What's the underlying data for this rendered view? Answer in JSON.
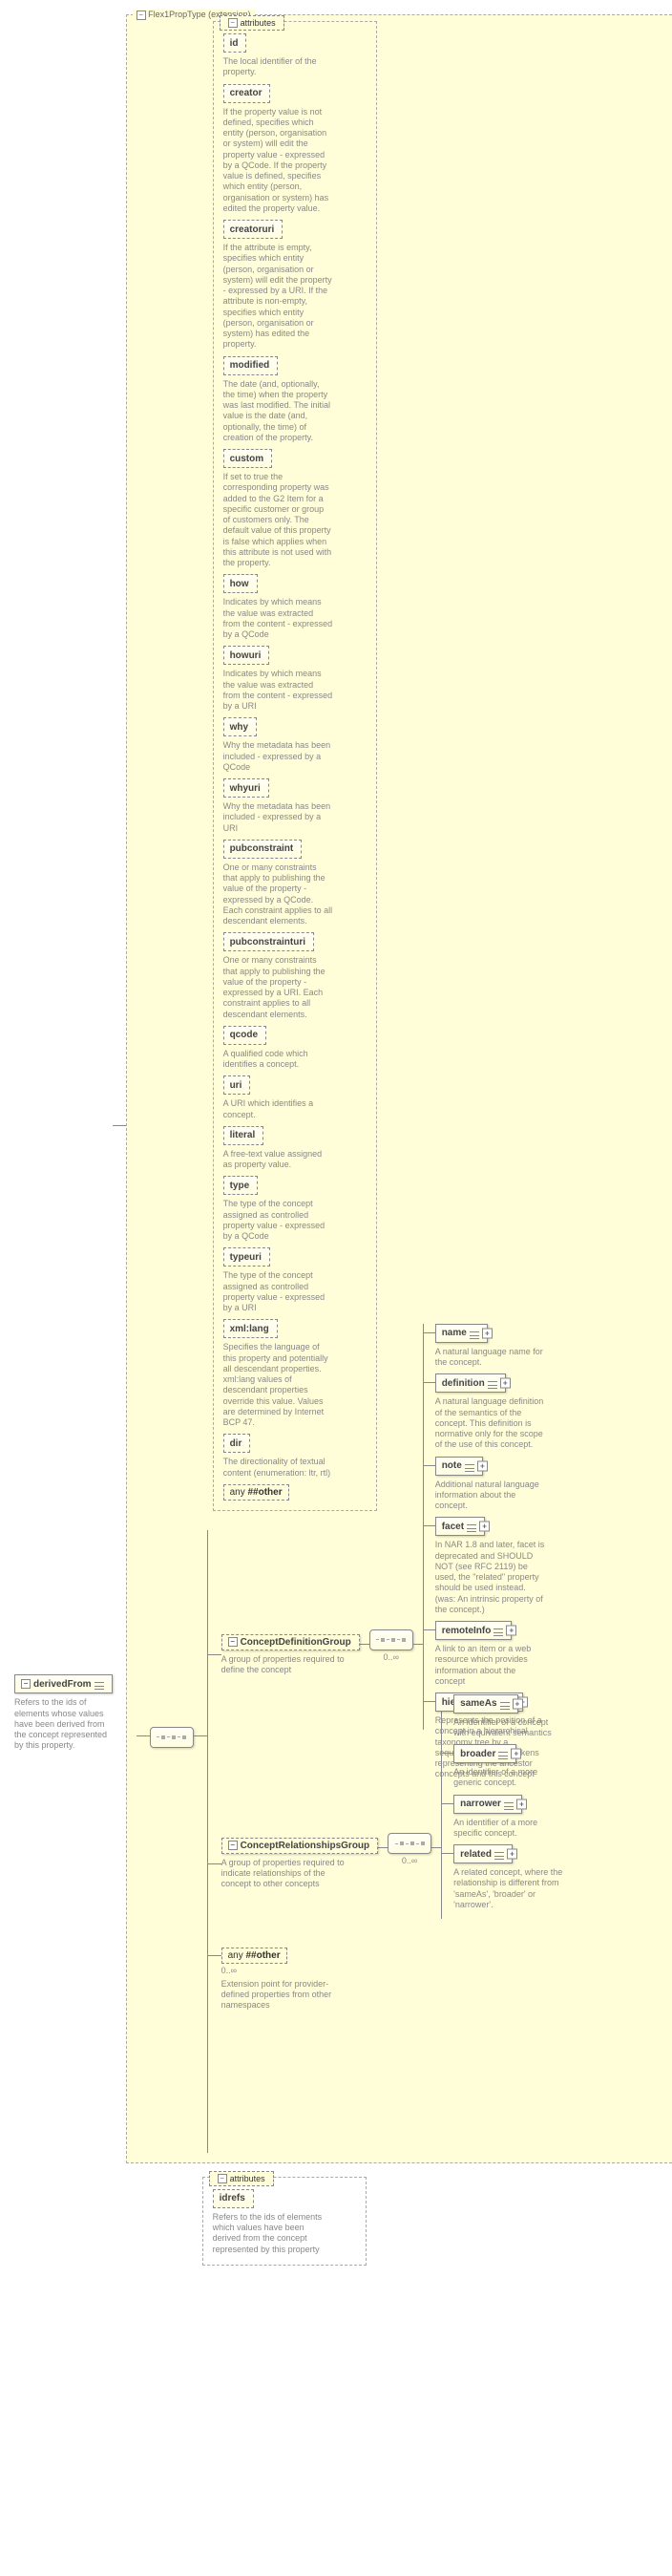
{
  "root": {
    "name": "derivedFrom",
    "desc": "Refers to the ids of elements whose values have been derived from the concept represented by this property."
  },
  "extension_label": "Flex1PropType (extension)",
  "attributes_label": "attributes",
  "attrs1": [
    {
      "name": "id",
      "desc": "The local identifier of the property."
    },
    {
      "name": "creator",
      "desc": "If the property value is not defined, specifies which entity (person, organisation or system) will edit the property value - expressed by a QCode. If the property value is defined, specifies which entity (person, organisation or system) has edited the property value."
    },
    {
      "name": "creatoruri",
      "desc": "If the attribute is empty, specifies which entity (person, organisation or system) will edit the property - expressed by a URI. If the attribute is non-empty, specifies which entity (person, organisation or system) has edited the property."
    },
    {
      "name": "modified",
      "desc": "The date (and, optionally, the time) when the property was last modified. The initial value is the date (and, optionally, the time) of creation of the property."
    },
    {
      "name": "custom",
      "desc": "If set to true the corresponding property was added to the G2 Item for a specific customer or group of customers only. The default value of this property is false which applies when this attribute is not used with the property."
    },
    {
      "name": "how",
      "desc": "Indicates by which means the value was extracted from the content - expressed by a QCode"
    },
    {
      "name": "howuri",
      "desc": "Indicates by which means the value was extracted from the content - expressed by a URI"
    },
    {
      "name": "why",
      "desc": "Why the metadata has been included - expressed by a QCode"
    },
    {
      "name": "whyuri",
      "desc": "Why the metadata has been included - expressed by a URI"
    },
    {
      "name": "pubconstraint",
      "desc": "One or many constraints that apply to publishing the value of the property - expressed by a QCode. Each constraint applies to all descendant elements."
    },
    {
      "name": "pubconstrainturi",
      "desc": "One or many constraints that apply to publishing the value of the property - expressed by a URI. Each constraint applies to all descendant elements."
    },
    {
      "name": "qcode",
      "desc": "A qualified code which identifies a concept."
    },
    {
      "name": "uri",
      "desc": "A URI which identifies a concept."
    },
    {
      "name": "literal",
      "desc": "A free-text value assigned as property value."
    },
    {
      "name": "type",
      "desc": "The type of the concept assigned as controlled property value - expressed by a QCode"
    },
    {
      "name": "typeuri",
      "desc": "The type of the concept assigned as controlled property value - expressed by a URI"
    },
    {
      "name": "xml:lang",
      "desc": "Specifies the language of this property and potentially all descendant properties. xml:lang values of descendant properties override this value. Values are determined by Internet BCP 47."
    },
    {
      "name": "dir",
      "desc": "The directionality of textual content (enumeration: ltr, rtl)"
    }
  ],
  "any_label": "any",
  "any_ns": "##other",
  "group1": {
    "name": "ConceptDefinitionGroup",
    "desc": "A group of properties required to define the concept",
    "occurs": "0..∞",
    "children": [
      {
        "name": "name",
        "desc": "A natural language name for the concept."
      },
      {
        "name": "definition",
        "desc": "A natural language definition of the semantics of the concept. This definition is normative only for the scope of the use of this concept."
      },
      {
        "name": "note",
        "desc": "Additional natural language information about the concept."
      },
      {
        "name": "facet",
        "desc": "In NAR 1.8 and later, facet is deprecated and SHOULD NOT (see RFC 2119) be used, the \"related\" property should be used instead.(was: An intrinsic property of the concept.)"
      },
      {
        "name": "remoteInfo",
        "desc": "A link to an item or a web resource which provides information about the concept"
      },
      {
        "name": "hierarchyInfo",
        "desc": "Represents the position of a concept in a hierarchical taxonomy tree by a sequence of QCode tokens representing the ancestor concepts and this concept"
      }
    ]
  },
  "group2": {
    "name": "ConceptRelationshipsGroup",
    "desc": "A group of properties required to indicate relationships of the concept to other concepts",
    "occurs": "0..∞",
    "children": [
      {
        "name": "sameAs",
        "desc": "An identifier of a concept with equivalent semantics"
      },
      {
        "name": "broader",
        "desc": "An identifier of a more generic concept."
      },
      {
        "name": "narrower",
        "desc": "An identifier of a more specific concept."
      },
      {
        "name": "related",
        "desc": "A related concept, where the relationship is different from 'sameAs', 'broader' or 'narrower'."
      }
    ]
  },
  "any2": {
    "label": "any",
    "ns": "##other",
    "occurs": "0..∞",
    "desc": "Extension point for provider-defined properties from other namespaces"
  },
  "attrs2": {
    "label": "attributes",
    "items": [
      {
        "name": "idrefs",
        "desc": "Refers to the ids of elements which values have been derived from the concept represented by this property"
      }
    ]
  }
}
